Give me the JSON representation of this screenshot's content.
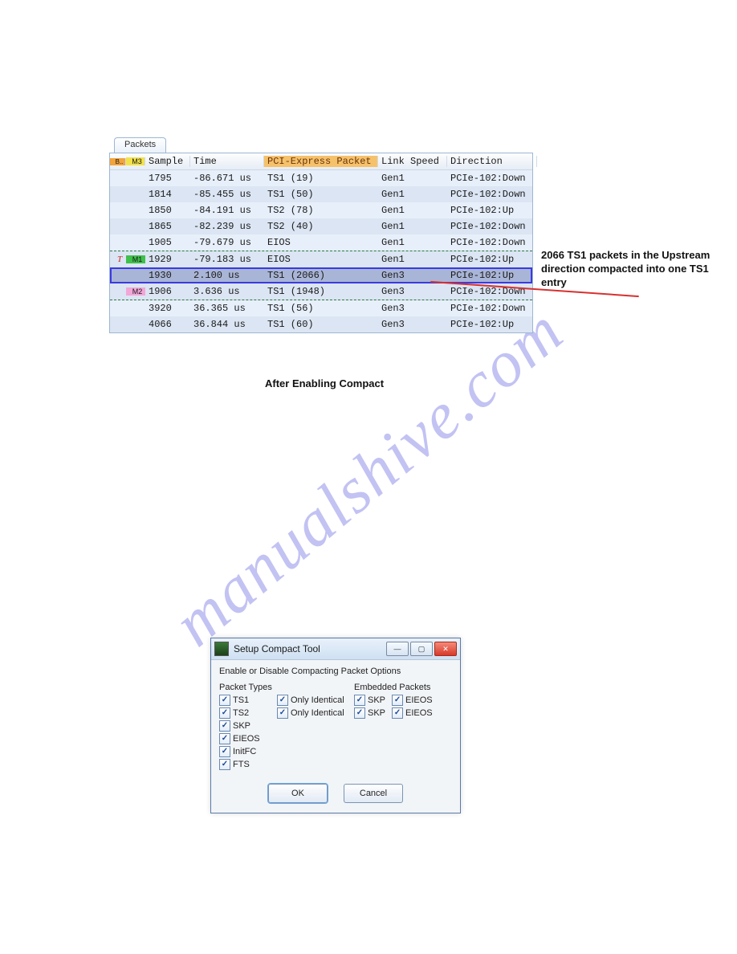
{
  "watermark": "manualshive.com",
  "packets": {
    "tab": "Packets",
    "columns": {
      "b": "B..",
      "m": "M3",
      "sample": "Sample",
      "time": "Time",
      "packet": "PCI-Express Packet",
      "speed": "Link Speed",
      "dir": "Direction"
    },
    "rows": [
      {
        "b": "",
        "m": "",
        "sample": "1795",
        "time": "-86.671 us",
        "packet": "TS1 (19)",
        "speed": "Gen1",
        "dir": "PCIe-102:Down",
        "cls": "rowA"
      },
      {
        "b": "",
        "m": "",
        "sample": "1814",
        "time": "-85.455 us",
        "packet": "TS1 (50)",
        "speed": "Gen1",
        "dir": "PCIe-102:Down",
        "cls": "rowB"
      },
      {
        "b": "",
        "m": "",
        "sample": "1850",
        "time": "-84.191 us",
        "packet": "TS2 (78)",
        "speed": "Gen1",
        "dir": "PCIe-102:Up",
        "cls": "rowA"
      },
      {
        "b": "",
        "m": "",
        "sample": "1865",
        "time": "-82.239 us",
        "packet": "TS2 (40)",
        "speed": "Gen1",
        "dir": "PCIe-102:Down",
        "cls": "rowB"
      },
      {
        "b": "",
        "m": "",
        "sample": "1905",
        "time": "-79.679 us",
        "packet": "EIOS",
        "speed": "Gen1",
        "dir": "PCIe-102:Down",
        "cls": "rowA"
      },
      {
        "b": "T",
        "m": "M1",
        "sample": "1929",
        "time": "-79.183 us",
        "packet": "EIOS",
        "speed": "Gen1",
        "dir": "PCIe-102:Up",
        "cls": "rowB dotted-top"
      },
      {
        "b": "",
        "m": "",
        "sample": "1930",
        "time": "2.100 us",
        "packet": "TS1 (2066)",
        "speed": "Gen3",
        "dir": "PCIe-102:Up",
        "cls": "rowA sel"
      },
      {
        "b": "",
        "m": "M2",
        "sample": "1906",
        "time": "3.636 us",
        "packet": "TS1 (1948)",
        "speed": "Gen3",
        "dir": "PCIe-102:Down",
        "cls": "rowB dotted-bot"
      },
      {
        "b": "",
        "m": "",
        "sample": "3920",
        "time": "36.365 us",
        "packet": "TS1 (56)",
        "speed": "Gen3",
        "dir": "PCIe-102:Down",
        "cls": "rowA"
      },
      {
        "b": "",
        "m": "",
        "sample": "4066",
        "time": "36.844 us",
        "packet": "TS1 (60)",
        "speed": "Gen3",
        "dir": "PCIe-102:Up",
        "cls": "rowB"
      }
    ]
  },
  "annotation": "2066 TS1 packets in the Upstream direction compacted into one TS1 entry",
  "caption1": "After Enabling Compact",
  "dialog": {
    "title": "Setup Compact Tool",
    "subtitle": "Enable or Disable Compacting Packet Options",
    "hdr_types": "Packet Types",
    "hdr_embedded": "Embedded Packets",
    "types": [
      "TS1",
      "TS2",
      "SKP",
      "EIEOS",
      "InitFC",
      "FTS"
    ],
    "only": "Only Identical",
    "emb1a": "SKP",
    "emb1b": "EIEOS",
    "emb2a": "SKP",
    "emb2b": "EIEOS",
    "ok": "OK",
    "cancel": "Cancel"
  }
}
